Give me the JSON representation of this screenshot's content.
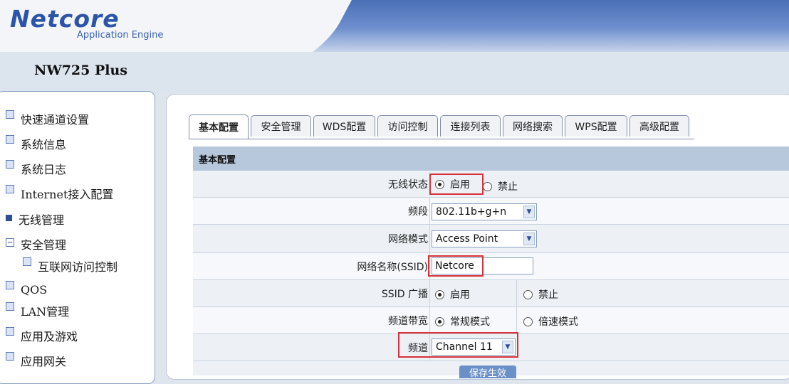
{
  "header": {
    "logo": "Netcore",
    "logo_sub": "Application Engine",
    "model": "NW725 Plus"
  },
  "sidebar": {
    "items": [
      {
        "label": "快速通道设置",
        "icon": "square-icon"
      },
      {
        "label": "系统信息",
        "icon": "square-icon"
      },
      {
        "label": "系统日志",
        "icon": "square-icon"
      },
      {
        "label": "Internet接入配置",
        "icon": "square-icon"
      },
      {
        "label": "无线管理",
        "icon": "arrow-right-icon"
      },
      {
        "label": "安全管理",
        "icon": "minus-icon"
      },
      {
        "label": "互联网访问控制",
        "icon": "square-icon"
      },
      {
        "label": "QOS",
        "icon": "square-icon"
      },
      {
        "label": "LAN管理",
        "icon": "square-icon"
      },
      {
        "label": "应用及游戏",
        "icon": "square-icon"
      },
      {
        "label": "应用网关",
        "icon": "square-icon"
      }
    ]
  },
  "tabs": [
    {
      "label": "基本配置",
      "active": true
    },
    {
      "label": "安全管理"
    },
    {
      "label": "WDS配置"
    },
    {
      "label": "访问控制"
    },
    {
      "label": "连接列表"
    },
    {
      "label": "网络搜索"
    },
    {
      "label": "WPS配置"
    },
    {
      "label": "高级配置"
    }
  ],
  "section_title": "基本配置",
  "form": {
    "wireless_status": {
      "label": "无线状态",
      "opt_on": "启用",
      "opt_off": "禁止",
      "selected": "启用"
    },
    "band": {
      "label": "频段",
      "value": "802.11b+g+n"
    },
    "mode": {
      "label": "网络模式",
      "value": "Access Point"
    },
    "ssid": {
      "label": "网络名称(SSID)",
      "value": "Netcore"
    },
    "ssid_broadcast": {
      "label": "SSID 广播",
      "opt_on": "启用",
      "opt_off": "禁止",
      "selected": "启用"
    },
    "bandwidth": {
      "label": "频道带宽",
      "opt_a": "常规模式",
      "opt_b": "倍速模式",
      "selected": "常规模式"
    },
    "channel": {
      "label": "频道",
      "value": "Channel 11"
    }
  },
  "save_button": "保存生效",
  "colors": {
    "highlight": "#d7323a",
    "header_blue": "#4a6fb6",
    "section_head": "#b7c7dc"
  }
}
